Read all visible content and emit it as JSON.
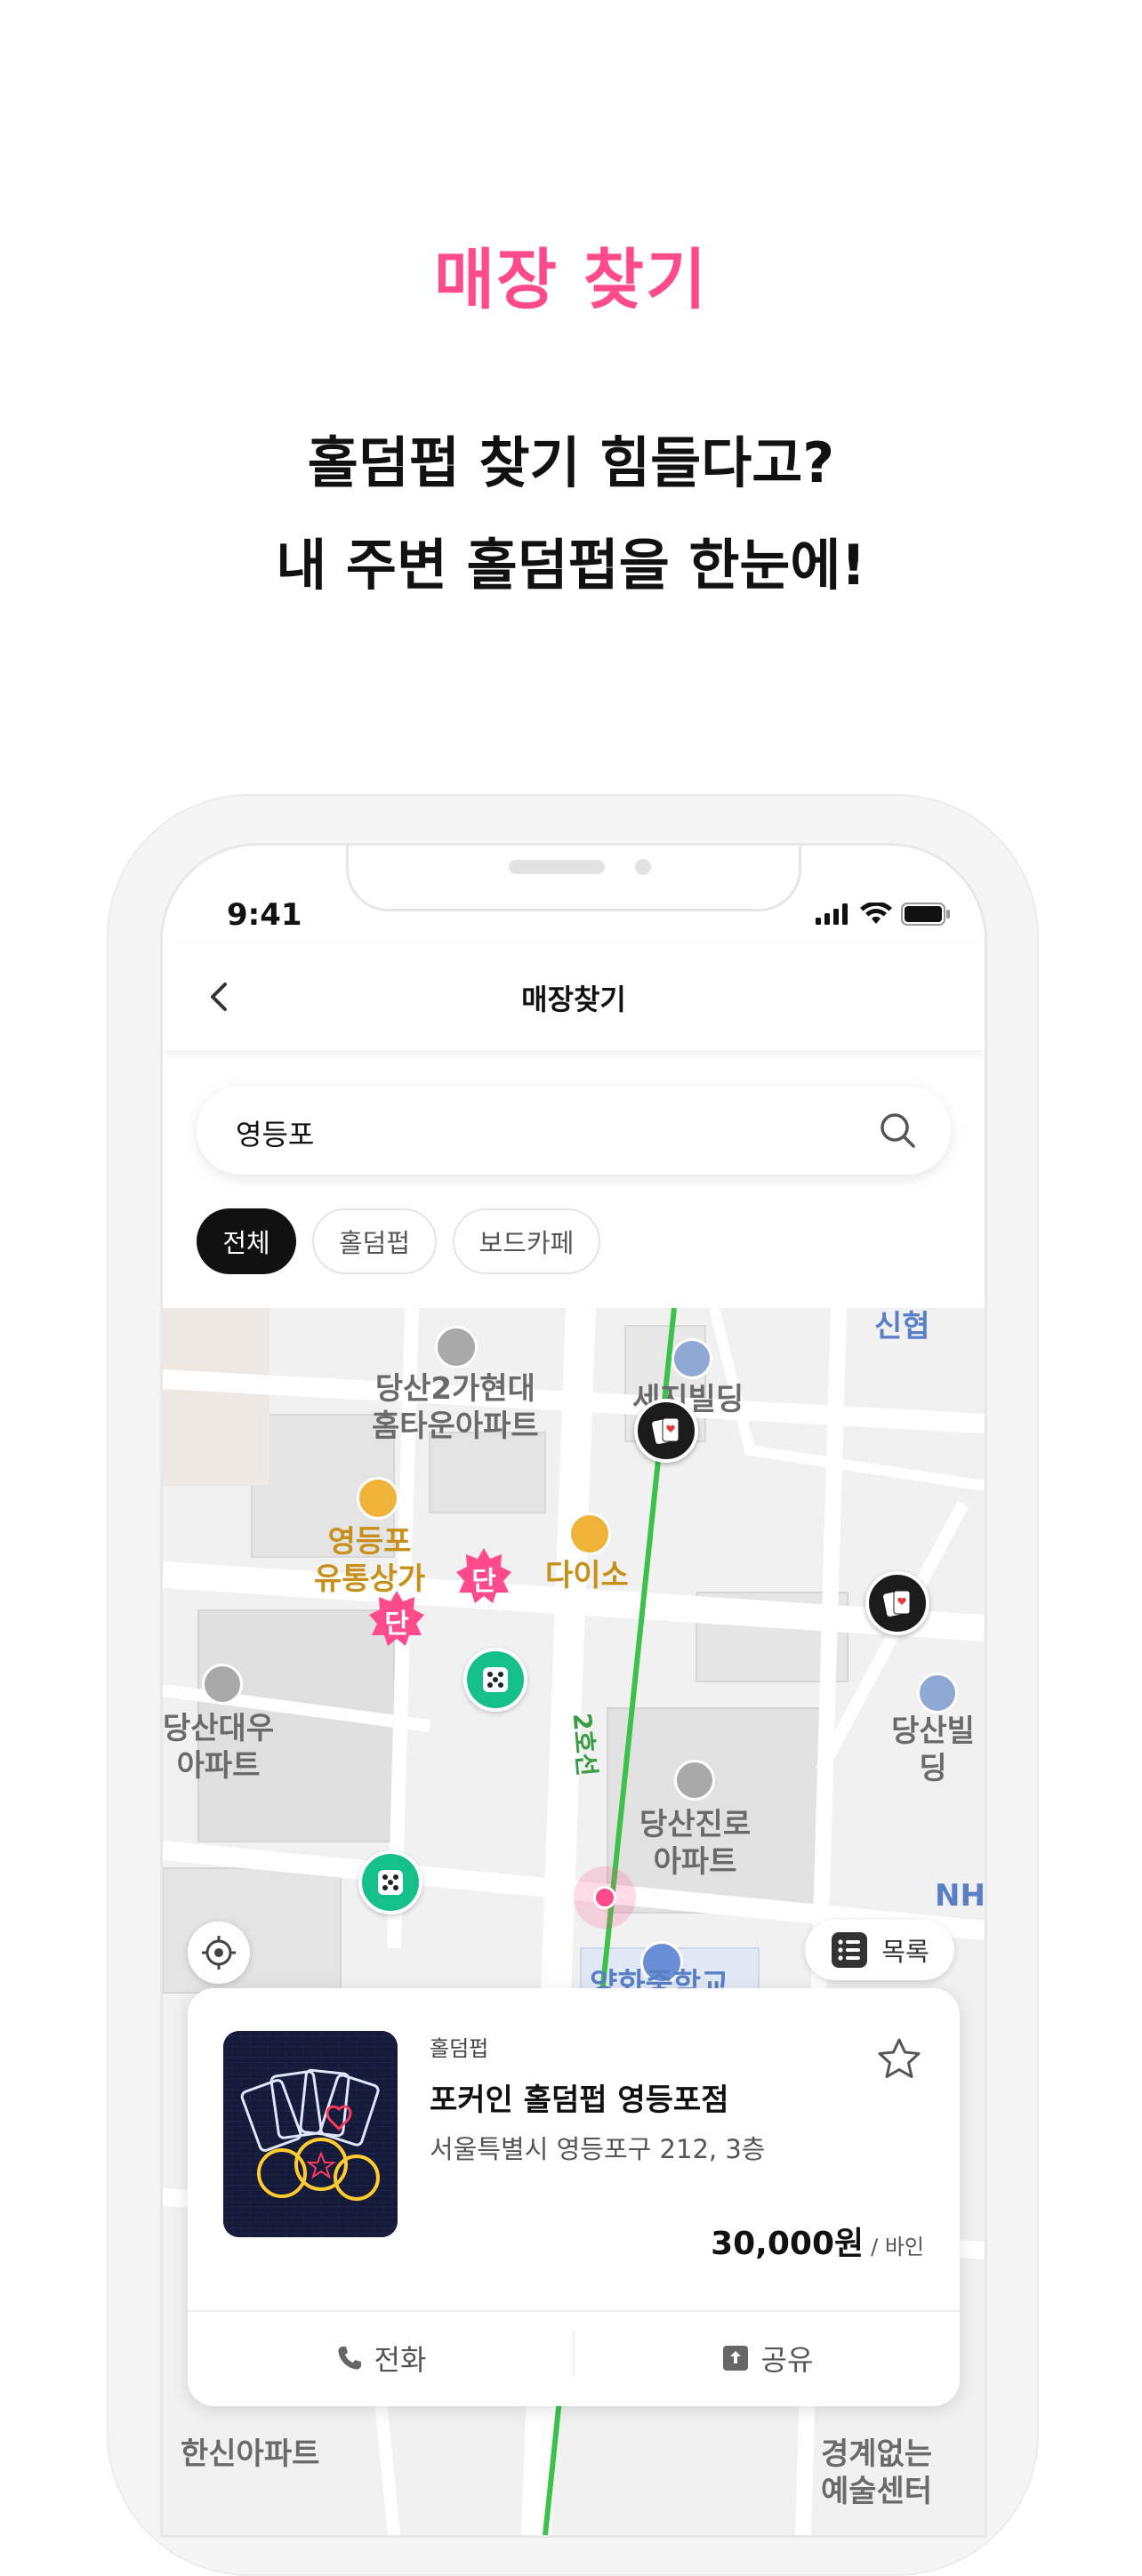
{
  "colors": {
    "accent": "#ff4b8b",
    "active_chip": "#111111",
    "subway_line": "#3cc24a",
    "pin_green": "#16c08a"
  },
  "promo": {
    "title": "매장 찾기",
    "headline_1": "홀덤펍 찾기 힘들다고?",
    "headline_2": "내 주변 홀덤펍을 한눈에!"
  },
  "status_bar": {
    "time": "9:41"
  },
  "header": {
    "title": "매장찾기",
    "back_icon": "chevron-left-icon"
  },
  "search": {
    "value": "영등포",
    "icon": "search-icon"
  },
  "filters": {
    "chips": [
      {
        "label": "전체",
        "selected": true
      },
      {
        "label": "홀덤펍",
        "selected": false
      },
      {
        "label": "보드카페",
        "selected": false
      }
    ]
  },
  "map": {
    "labels": {
      "apt_hyundai": "당산2가현대\n홈타운아파트",
      "seji": "세지빌딩",
      "sinhyeop": "신협",
      "yeongdeungpo_market": "영등포\n유통상가",
      "daiso": "다이소",
      "daewoo": "당산대우\n아파트",
      "dangsan_bldg": "당산빌딩",
      "jinro": "당산진로\n아파트",
      "line2": "2호선",
      "nh": "NH",
      "school": "양화중학교",
      "hansin": "한신아파트",
      "art_center": "경계없는\n예술센터"
    },
    "badge_text": "단",
    "list_button": "목록"
  },
  "store_card": {
    "category": "홀덤펍",
    "name": "포커인 홀덤펍 영등포점",
    "address": "서울특별시 영등포구 212, 3층",
    "price": "30,000원",
    "price_unit": "/ 바인",
    "actions": {
      "call": "전화",
      "share": "공유"
    }
  }
}
